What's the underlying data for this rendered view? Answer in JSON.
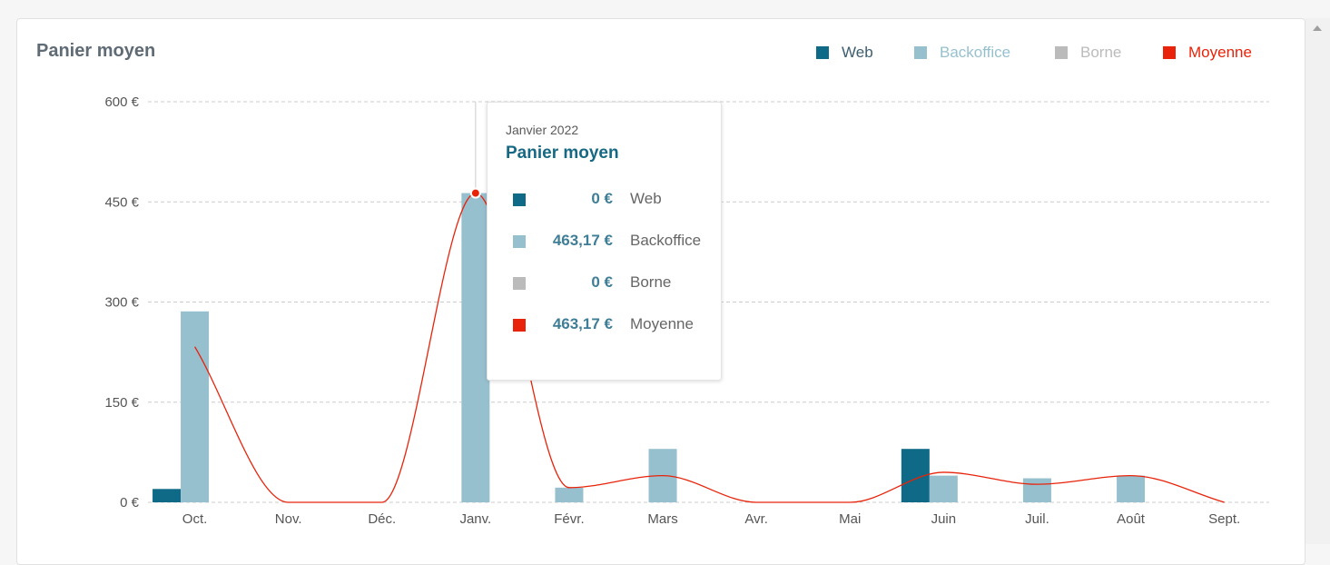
{
  "card": {
    "title": "Panier moyen"
  },
  "legend": [
    {
      "name": "Web",
      "color": "#0e6a86",
      "text_color": "#3d5e70"
    },
    {
      "name": "Backoffice",
      "color": "#97c0cf",
      "text_color": "#97c0cf"
    },
    {
      "name": "Borne",
      "color": "#bbbbbb",
      "text_color": "#bbbbbb"
    },
    {
      "name": "Moyenne",
      "color": "#e8230a",
      "text_color": "#e8230a"
    }
  ],
  "chart_data": {
    "type": "bar",
    "title": "Panier moyen",
    "categories": [
      "Oct.",
      "Nov.",
      "Déc.",
      "Janv.",
      "Févr.",
      "Mars",
      "Avr.",
      "Mai",
      "Juin",
      "Juil.",
      "Août",
      "Sept."
    ],
    "y_ticks": [
      "600 €",
      "450 €",
      "300 €",
      "150 €",
      "0 €"
    ],
    "y_tick_values": [
      600,
      450,
      300,
      150,
      0
    ],
    "ylim": [
      0,
      600
    ],
    "grid": true,
    "legend_position": "top-right",
    "series": [
      {
        "name": "Web",
        "type": "bar",
        "color": "#0e6a86",
        "values": [
          20,
          0,
          0,
          0,
          0,
          0,
          0,
          0,
          80,
          0,
          0,
          0
        ]
      },
      {
        "name": "Backoffice",
        "type": "bar",
        "color": "#97c0cf",
        "values": [
          286,
          0,
          0,
          463.17,
          22,
          80,
          0,
          0,
          40,
          36,
          40,
          0
        ]
      },
      {
        "name": "Borne",
        "type": "bar",
        "color": "#bbbbbb",
        "values": [
          0,
          0,
          0,
          0,
          0,
          0,
          0,
          0,
          0,
          0,
          0,
          0
        ]
      },
      {
        "name": "Moyenne",
        "type": "line",
        "color": "#e8230a",
        "values": [
          233,
          0,
          0,
          463.17,
          22,
          40,
          0,
          0,
          45,
          27,
          40,
          0
        ]
      }
    ]
  },
  "tooltip": {
    "date": "Janvier 2022",
    "title": "Panier moyen",
    "category_index": 3,
    "rows": [
      {
        "value": "0 €",
        "label": "Web",
        "color": "#0e6a86"
      },
      {
        "value": "463,17 €",
        "label": "Backoffice",
        "color": "#97c0cf"
      },
      {
        "value": "0 €",
        "label": "Borne",
        "color": "#bbbbbb"
      },
      {
        "value": "463,17 €",
        "label": "Moyenne",
        "color": "#e8230a"
      }
    ]
  }
}
